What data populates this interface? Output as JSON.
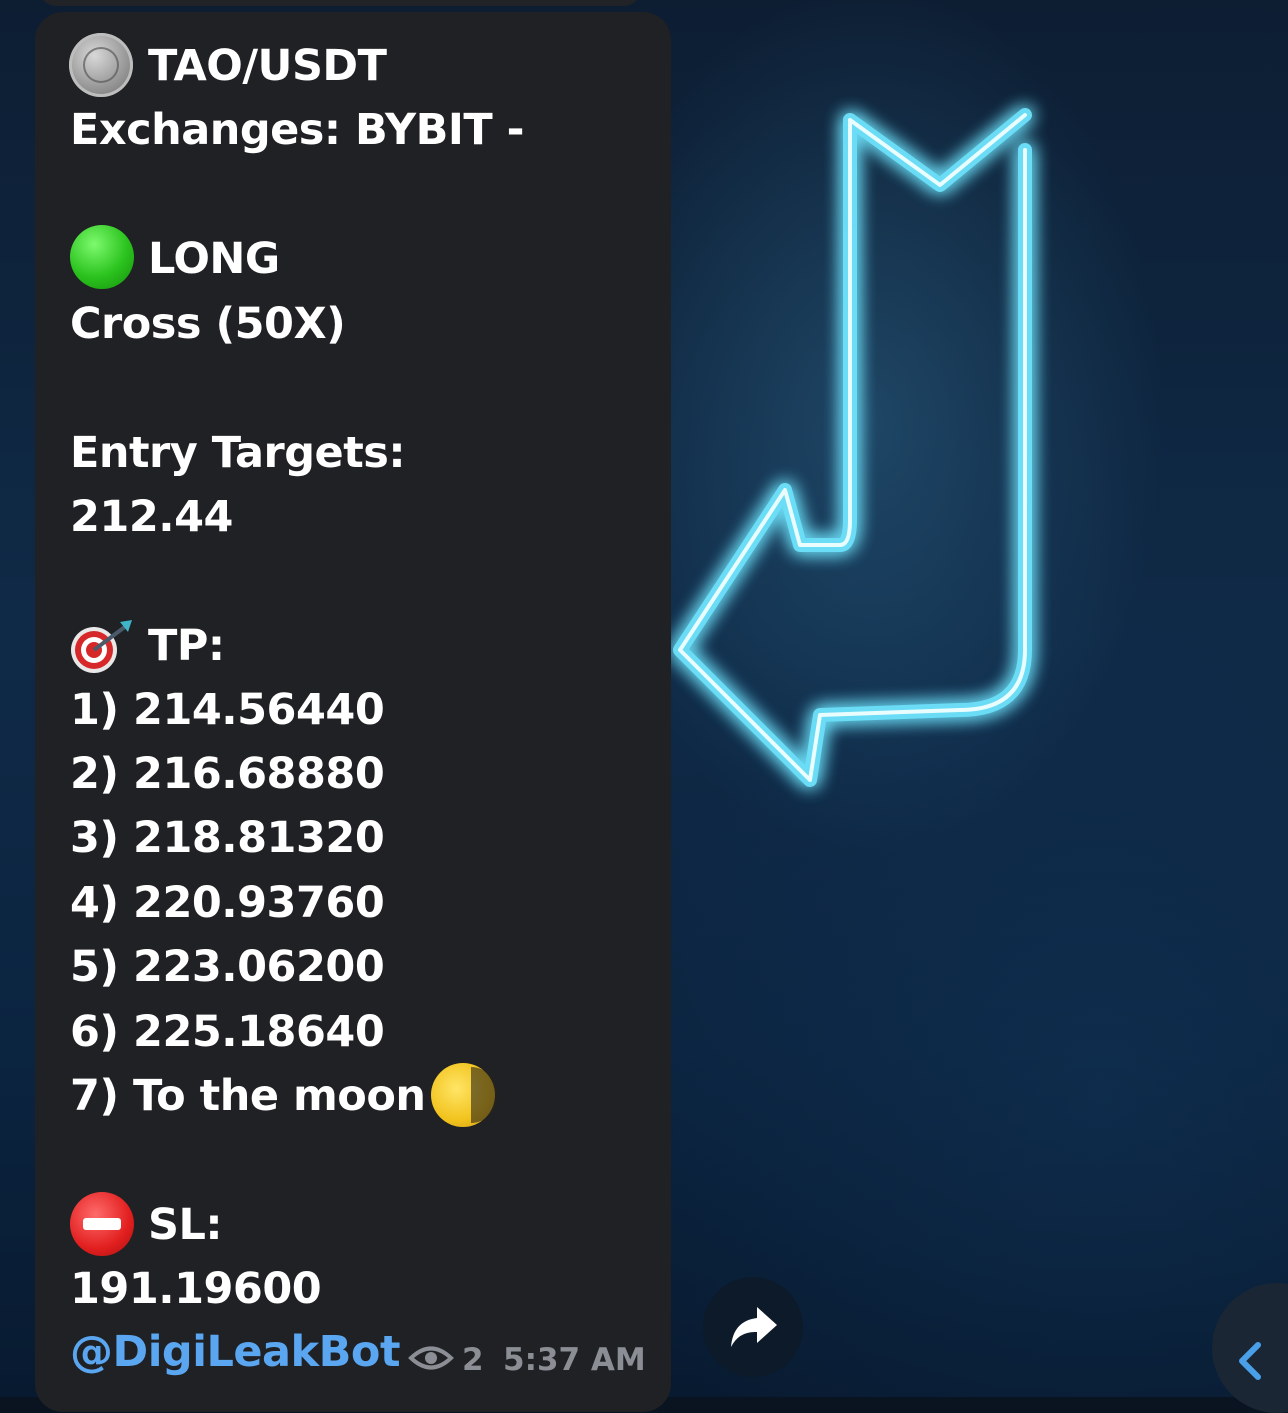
{
  "message": {
    "pair": "TAO/USDT",
    "exchanges": "Exchanges: BYBIT -",
    "side": "LONG",
    "margin": "Cross (50X)",
    "entry_label": "Entry Targets:",
    "entry_value": "212.44",
    "tp_label": "TP:",
    "tp_items": [
      "1) 214.56440",
      "2) 216.68880",
      "3) 218.81320",
      "4) 220.93760",
      "5) 223.06200",
      "6) 225.18640",
      "7) To the moon"
    ],
    "sl_label": "SL:",
    "sl_value": "191.19600",
    "handle": "@DigiLeakBot",
    "views": "2",
    "time": "5:37 AM"
  },
  "icons": {
    "coin": "tao-coin-icon",
    "side": "green-circle-icon",
    "tp": "direct-hit-icon",
    "moon": "moon-icon",
    "sl": "no-entry-icon",
    "views": "eye-icon",
    "share": "share-icon",
    "scroll": "chevron-left-icon"
  },
  "colors": {
    "bubble": "#1f2124",
    "text": "#ffffff",
    "link": "#5aa6f0",
    "meta": "#8b8f95",
    "neon": "#6fe6ff"
  }
}
